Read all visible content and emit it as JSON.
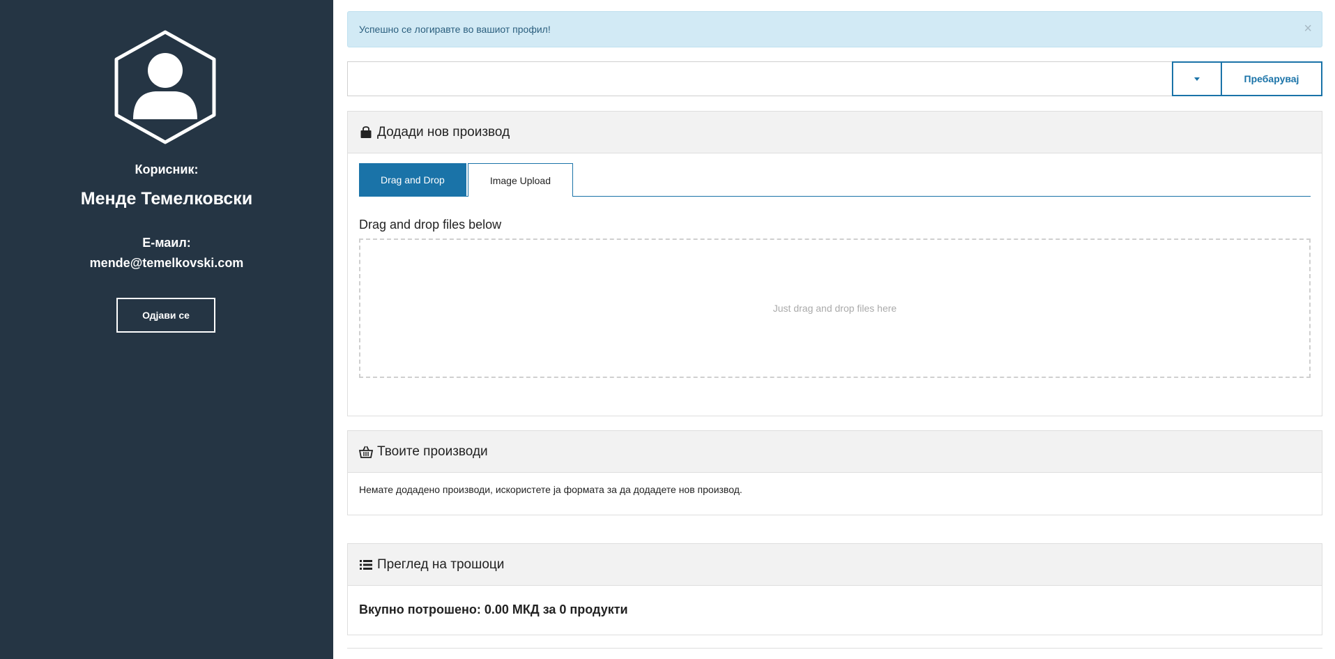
{
  "sidebar": {
    "user_label": "Корисник:",
    "user_name": "Менде Темелковски",
    "email_label": "Е-маил:",
    "email_value": "mende@temelkovski.com",
    "logout_label": "Одјави се",
    "avatar_icon": "user-hexagon-icon"
  },
  "alert": {
    "message": "Успешно се логиравте во вашиот профил!",
    "close_label": "×"
  },
  "search": {
    "placeholder": "",
    "value": "",
    "button_label": "Пребарувај"
  },
  "add_product": {
    "title": "Додади нов производ",
    "icon": "shopping-bag-icon",
    "tabs": [
      {
        "label": "Drag and Drop",
        "active": true
      },
      {
        "label": "Image Upload",
        "active": false
      }
    ],
    "dropzone_title": "Drag and drop files below",
    "dropzone_hint": "Just drag and drop files here"
  },
  "your_products": {
    "title": "Твоите производи",
    "icon": "basket-icon",
    "empty_message": "Немате додадено производи, искористете ја формата за да додадете нов производ."
  },
  "expenses": {
    "title": "Преглед на трошоци",
    "icon": "list-icon",
    "total_text": "Вкупно потрошено: 0.00 МКД за 0 продукти"
  },
  "colors": {
    "sidebar_bg": "#253544",
    "accent": "#1a73a8",
    "alert_bg": "#d2eaf5"
  }
}
